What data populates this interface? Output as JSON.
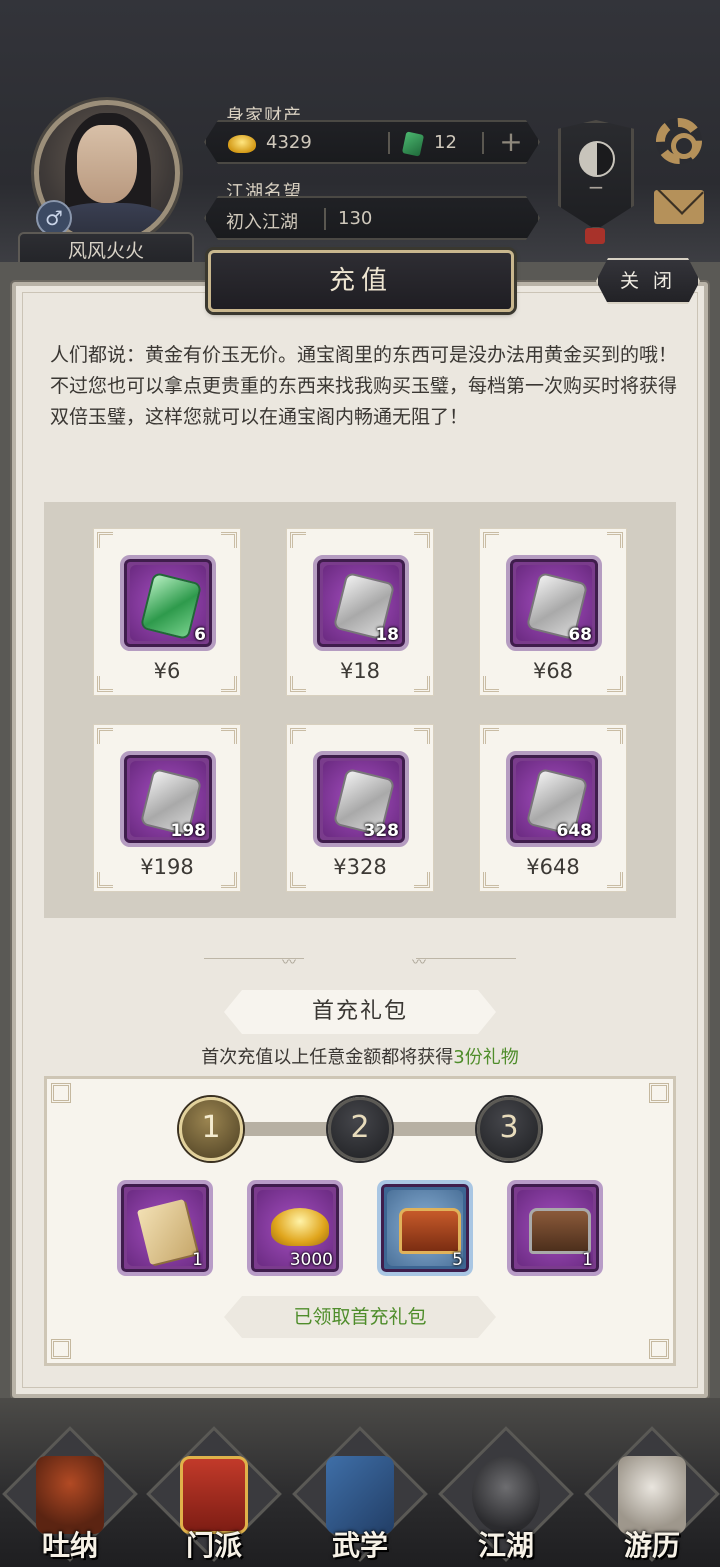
{
  "header": {
    "player_name": "风风火火",
    "gender_symbol": "♂",
    "wealth_label": "身家财产",
    "gold": "4329",
    "jade": "12",
    "plus_symbol": "+",
    "reputation_label": "江湖名望",
    "rank_title": "初入江湖",
    "reputation_value": "130",
    "taiji_minus": "−"
  },
  "modal": {
    "title": "充值",
    "close_label": "关 闭",
    "intro_line1": "人们都说：黄金有价玉无价。通宝阁里的东西可是没办法用黄金买到的哦！",
    "intro_line2": "不过您也可以拿点更贵重的东西来找我购买玉璧，每档第一次购买时将获得双倍玉璧，这样您就可以在通宝阁内畅通无阻了！",
    "products": [
      {
        "count": "6",
        "price": "¥6",
        "kind": "green-jade"
      },
      {
        "count": "18",
        "price": "¥18",
        "kind": "white-jade"
      },
      {
        "count": "68",
        "price": "¥68",
        "kind": "white-jade"
      },
      {
        "count": "198",
        "price": "¥198",
        "kind": "white-jade"
      },
      {
        "count": "328",
        "price": "¥328",
        "kind": "white-jade"
      },
      {
        "count": "648",
        "price": "¥648",
        "kind": "white-jade"
      }
    ],
    "first_pack": {
      "title": "首充礼包",
      "desc_prefix": "首次充值以上任意金额都将获得",
      "desc_highlight": "3份礼物",
      "steps": [
        "1",
        "2",
        "3"
      ],
      "rewards": [
        {
          "icon": "book-icon",
          "count": "1"
        },
        {
          "icon": "gold-ingot-icon",
          "count": "3000"
        },
        {
          "icon": "red-chest-icon",
          "count": "5"
        },
        {
          "icon": "wood-chest-icon",
          "count": "1"
        }
      ],
      "claimed_label": "已领取首充礼包"
    }
  },
  "nav": [
    {
      "label": "吐纳",
      "icon": "rooster-icon"
    },
    {
      "label": "门派",
      "icon": "banner-icon"
    },
    {
      "label": "武学",
      "icon": "manual-icon"
    },
    {
      "label": "江湖",
      "icon": "hat-icon"
    },
    {
      "label": "游历",
      "icon": "horse-icon"
    }
  ],
  "colors": {
    "accent_green": "#4f8d2b",
    "item_purple": "#7a3c8c",
    "gold": "#b5915a"
  }
}
